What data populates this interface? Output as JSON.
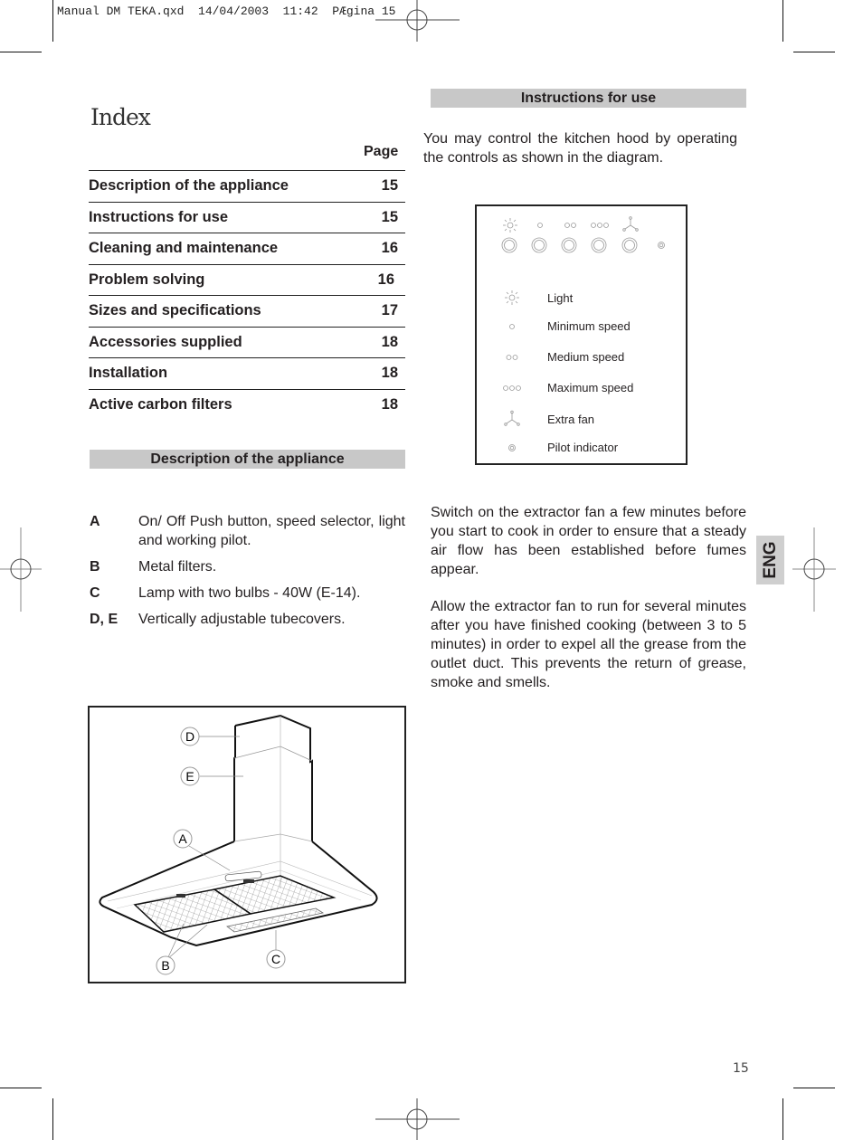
{
  "slug": "Manual DM TEKA.qxd  14/04/2003  11:42  PÆgina 15",
  "index": {
    "title": "Index",
    "page_header": "Page",
    "entries": [
      {
        "label": "Description of the appliance",
        "page": "15"
      },
      {
        "label": "Instructions for use",
        "page": "15"
      },
      {
        "label": "Cleaning and maintenance",
        "page": "16"
      },
      {
        "label": "Problem solving",
        "page": "16"
      },
      {
        "label": "Sizes and specifications",
        "page": "17"
      },
      {
        "label": "Accessories supplied",
        "page": "18"
      },
      {
        "label": "Installation",
        "page": "18"
      },
      {
        "label": "Active carbon filters",
        "page": "18"
      }
    ]
  },
  "description": {
    "heading": "Description  of the appliance",
    "items": [
      {
        "key": "A",
        "text": "On/ Off Push button, speed selector, light and working pilot."
      },
      {
        "key": "B",
        "text": "Metal filters."
      },
      {
        "key": "C",
        "text": "Lamp with two bulbs - 40W (E-14)."
      },
      {
        "key": "D, E",
        "text": "Vertically adjustable tubecovers."
      }
    ],
    "figure_labels": {
      "a": "A",
      "b": "B",
      "c": "C",
      "d": "D",
      "e": "E"
    }
  },
  "instructions": {
    "heading": "Instructions for use",
    "intro": "You may control the kitchen hood by operating the controls as shown in the diagram.",
    "controls_legend": [
      {
        "icon": "light-icon",
        "label": "Light"
      },
      {
        "icon": "minimum-speed-icon",
        "label": "Minimum speed"
      },
      {
        "icon": "medium-speed-icon",
        "label": "Medium speed"
      },
      {
        "icon": "maximum-speed-icon",
        "label": "Maximum speed"
      },
      {
        "icon": "extra-fan-icon",
        "label": "Extra fan"
      },
      {
        "icon": "pilot-indicator-icon",
        "label": "Pilot indicator"
      }
    ],
    "para1": "Switch on the extractor fan a few minutes before you start to cook in order to ensure that a steady air flow has been established before fumes appear.",
    "para2": "Allow the extractor fan to run for several minutes after you have finished cooking (between 3 to 5 minutes) in order to expel all the grease from the outlet duct. This prevents the return of grease, smoke and smells."
  },
  "language_tab": "ENG",
  "page_number": "15"
}
